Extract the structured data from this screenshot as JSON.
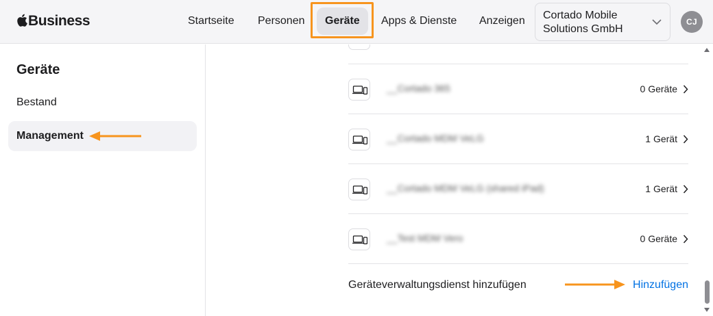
{
  "brand": {
    "name": "Business",
    "logo_icon": "apple-logo-icon"
  },
  "nav": {
    "items": [
      {
        "label": "Startseite"
      },
      {
        "label": "Personen"
      },
      {
        "label": "Geräte",
        "active": true
      },
      {
        "label": "Apps & Dienste"
      },
      {
        "label": "Anzeigen"
      }
    ]
  },
  "org_selector": {
    "name": "Cortado Mobile Solutions GmbH",
    "icon": "chevron-down-icon"
  },
  "user": {
    "initials": "CJ"
  },
  "sidebar": {
    "title": "Geräte",
    "items": [
      {
        "label": "Bestand"
      },
      {
        "label": "Management",
        "selected": true
      }
    ]
  },
  "services": {
    "rows": [
      {
        "name": "__Cortado 365",
        "count": "0 Geräte"
      },
      {
        "name": "__Cortado MDM VeLG",
        "count": "1 Gerät"
      },
      {
        "name": "__Cortado MDM VeLG (shared iPad)",
        "count": "1 Gerät"
      },
      {
        "name": "__Test MDM Vero",
        "count": "0 Geräte"
      }
    ],
    "add_label": "Geräteverwaltungsdienst hinzufügen",
    "add_link": "Hinzufügen"
  },
  "colors": {
    "highlight": "#f7941d",
    "link": "#0071e3",
    "sidebar_selected": "#f2f2f5"
  }
}
